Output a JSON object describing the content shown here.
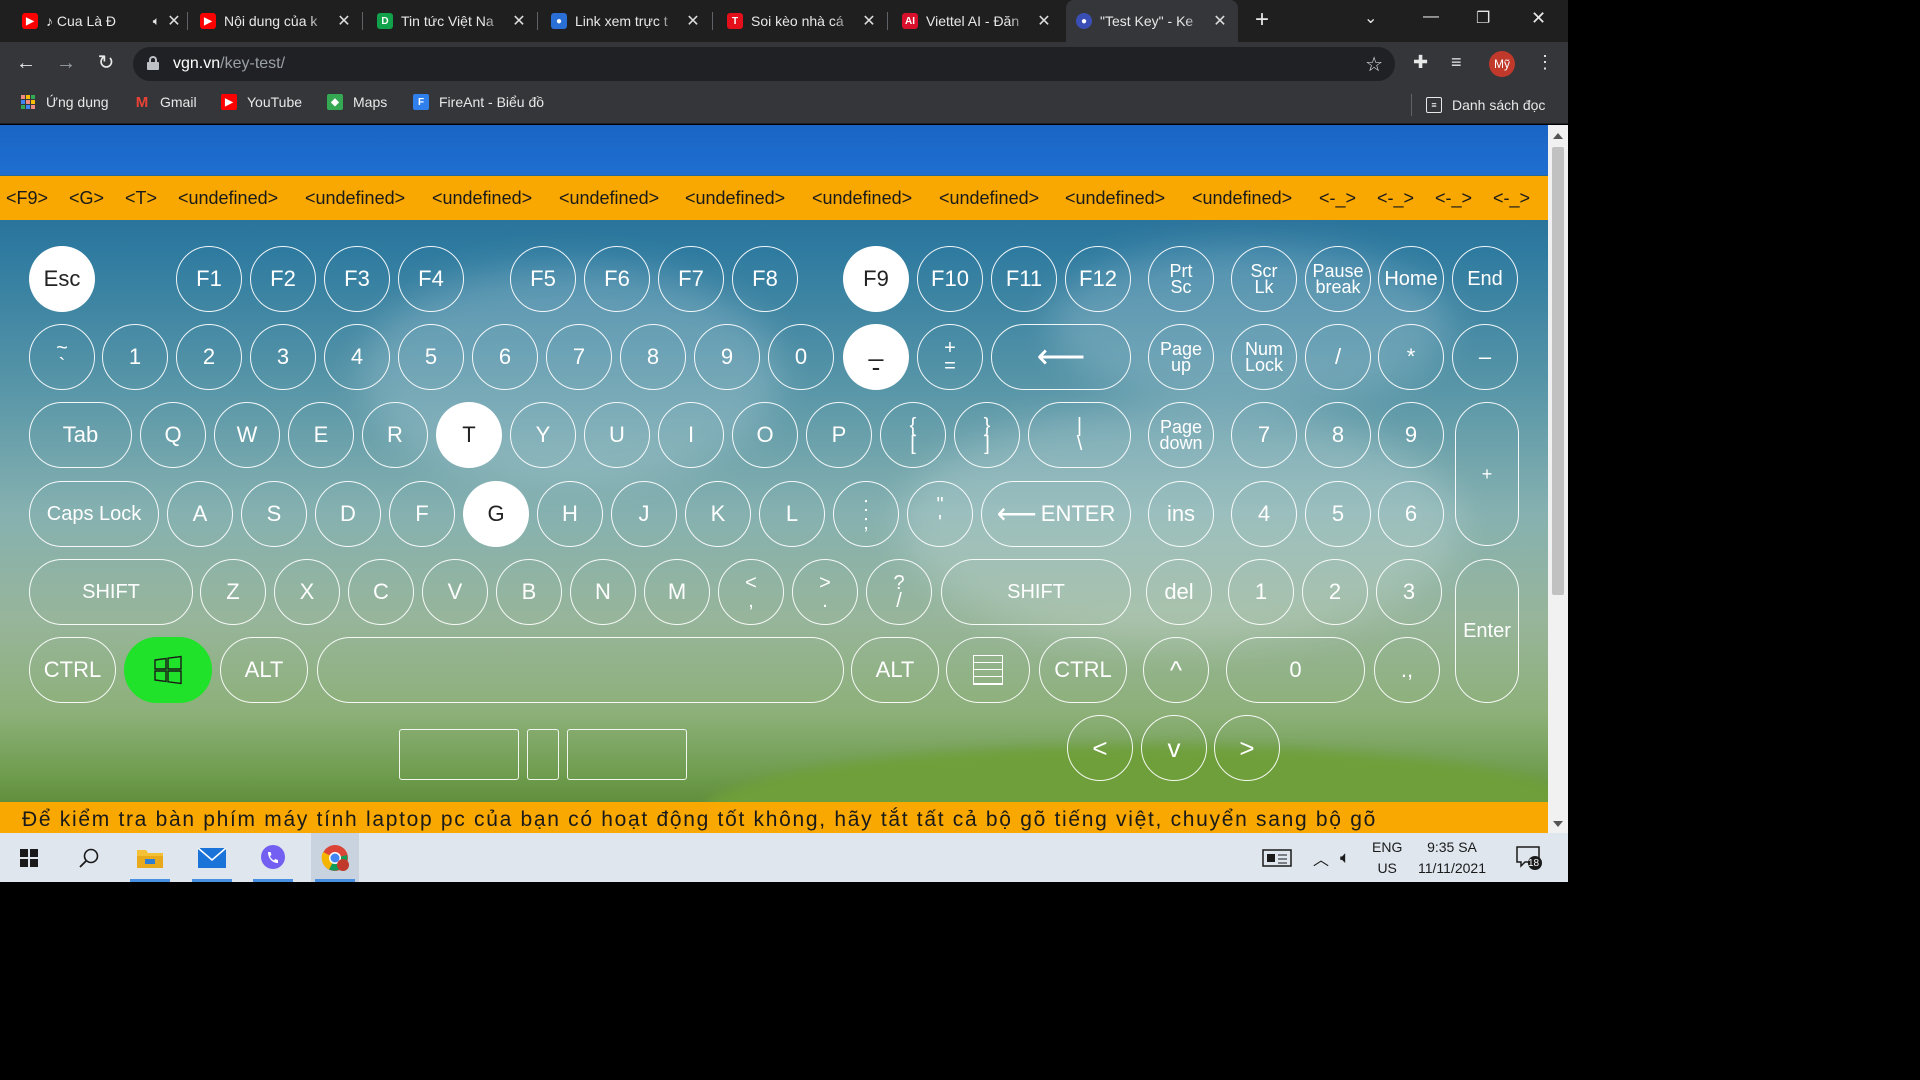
{
  "browser": {
    "tabs": [
      {
        "title": "♪ Cua Là Đ",
        "icon": "youtube-icon",
        "color": "#ff0000"
      },
      {
        "title": "Nội dung của k",
        "icon": "youtube-icon",
        "color": "#ff0000"
      },
      {
        "title": "Tin tức Việt Na",
        "icon": "d-icon",
        "color": "#12a14b"
      },
      {
        "title": "Link xem trực t",
        "icon": "site-icon",
        "color": "#2a6fd6"
      },
      {
        "title": "Soi kèo nhà cá",
        "icon": "t-icon",
        "color": "#e3101b"
      },
      {
        "title": "Viettel AI - Đăn",
        "icon": "ai-icon",
        "color": "#d8102b"
      },
      {
        "title": "\"Test Key\" - Ke",
        "icon": "site-icon",
        "color": "#3a4fb5"
      }
    ],
    "active_tab_index": 6,
    "url_host": "vgn.vn",
    "url_path": "/key-test/",
    "profile_initial": "Mỹ",
    "bookmarks": [
      {
        "label": "Ứng dụng",
        "icon": "apps-grid-icon"
      },
      {
        "label": "Gmail",
        "icon": "gmail-icon"
      },
      {
        "label": "YouTube",
        "icon": "youtube-icon"
      },
      {
        "label": "Maps",
        "icon": "maps-icon"
      },
      {
        "label": "FireAnt - Biểu đồ",
        "icon": "fireant-icon"
      }
    ],
    "reading_list_label": "Danh sách đọc"
  },
  "page": {
    "recent_keys": [
      "<F9>",
      "<G>",
      "<T>",
      "<undefined>",
      "<undefined>",
      "<undefined>",
      "<undefined>",
      "<undefined>",
      "<undefined>",
      "<undefined>",
      "<undefined>",
      "<undefined>",
      "<-_>",
      "<-_>",
      "<-_>",
      "<-_>"
    ],
    "footer_text": "Để kiểm tra bàn phím máy tính laptop pc của bạn có hoạt động tốt không, hãy tắt tất cả bộ gõ tiếng việt, chuyển sang bộ gõ",
    "colors": {
      "accent_band": "#f8a800",
      "pressed_key": "#ffffff",
      "win_key": "#21e22a"
    },
    "keys": {
      "esc": "Esc",
      "f1": "F1",
      "f2": "F2",
      "f3": "F3",
      "f4": "F4",
      "f5": "F5",
      "f6": "F6",
      "f7": "F7",
      "f8": "F8",
      "f9": "F9",
      "f10": "F10",
      "f11": "F11",
      "f12": "F12",
      "prtsc_1": "Prt",
      "prtsc_2": "Sc",
      "scrlk_1": "Scr",
      "scrlk_2": "Lk",
      "pause_1": "Pause",
      "pause_2": "break",
      "home": "Home",
      "end": "End",
      "tilde_1": "~",
      "tilde_2": "`",
      "d1": "1",
      "d2": "2",
      "d3": "3",
      "d4": "4",
      "d5": "5",
      "d6": "6",
      "d7": "7",
      "d8": "8",
      "d9": "9",
      "d0": "0",
      "minus_1": "_",
      "minus_2": "-",
      "plus_1": "+",
      "plus_2": "=",
      "backspace": "⟵",
      "pageup_1": "Page",
      "pageup_2": "up",
      "numlock_1": "Num",
      "numlock_2": "Lock",
      "np_div": "/",
      "np_mul": "*",
      "np_sub": "–",
      "tab": "Tab",
      "q": "Q",
      "w": "W",
      "e": "E",
      "r": "R",
      "t": "T",
      "y": "Y",
      "u": "U",
      "i": "I",
      "o": "O",
      "p": "P",
      "lbracket_1": "{",
      "lbracket_2": "[",
      "rbracket_1": "}",
      "rbracket_2": "]",
      "backslash_1": "|",
      "backslash_2": "\\",
      "pagedown_1": "Page",
      "pagedown_2": "down",
      "np7": "7",
      "np8": "8",
      "np9": "9",
      "np_add": "+",
      "capslock": "Caps Lock",
      "a": "A",
      "s": "S",
      "d": "D",
      "f": "F",
      "g": "G",
      "h": "H",
      "j": "J",
      "k": "K",
      "l": "L",
      "semicolon_1": ":",
      "semicolon_2": ";",
      "quote_1": "\"",
      "quote_2": "'",
      "enter": "ENTER",
      "enter_arrow": "⟵",
      "ins": "ins",
      "np4": "4",
      "np5": "5",
      "np6": "6",
      "lshift": "SHIFT",
      "z": "Z",
      "x": "X",
      "c": "C",
      "v": "V",
      "b": "B",
      "n": "N",
      "m": "M",
      "comma_1": "<",
      "comma_2": ",",
      "period_1": ">",
      "period_2": ".",
      "slash_1": "?",
      "slash_2": "/",
      "rshift": "SHIFT",
      "del": "del",
      "np1": "1",
      "np2": "2",
      "np3": "3",
      "np_enter": "Enter",
      "lctrl": "CTRL",
      "lalt": "ALT",
      "ralt": "ALT",
      "rctrl": "CTRL",
      "up": "^",
      "np0": "0",
      "np_dot": ".,",
      "left": "<",
      "down": "v",
      "right": ">"
    },
    "pressed": [
      "esc",
      "f9",
      "minus",
      "t",
      "g"
    ]
  },
  "taskbar": {
    "apps": [
      "start-icon",
      "search-icon",
      "file-explorer-icon",
      "mail-icon",
      "viber-icon",
      "chrome-icon"
    ],
    "lang_1": "ENG",
    "lang_2": "US",
    "time": "9:35 SA",
    "date": "11/11/2021",
    "notifications": "18"
  }
}
